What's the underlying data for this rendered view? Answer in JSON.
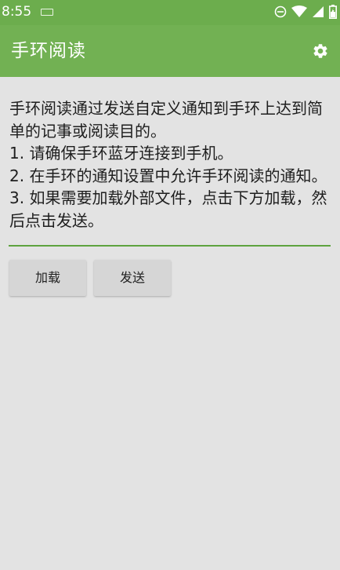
{
  "status_bar": {
    "time": "8:55",
    "icons": [
      "keyboard-icon",
      "dnd-icon",
      "wifi-icon",
      "signal-icon",
      "battery-icon"
    ]
  },
  "app_bar": {
    "title": "手环阅读",
    "settings_icon": "gear-icon",
    "color": "#72b153"
  },
  "main": {
    "text_content": "手环阅读通过发送自定义通知到手环上达到简单的记事或阅读目的。\n1. 请确保手环蓝牙连接到手机。\n2. 在手环的通知设置中允许手环阅读的通知。\n3. 如果需要加载外部文件，点击下方加载，然后点击发送。",
    "accent_color": "#5ea33e"
  },
  "buttons": {
    "load_label": "加载",
    "send_label": "发送"
  }
}
